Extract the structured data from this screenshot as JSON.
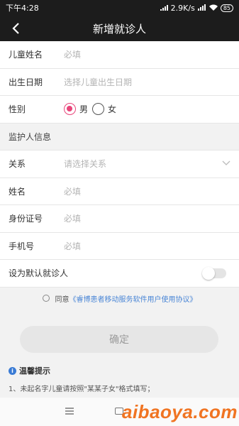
{
  "status_bar": {
    "time": "下午4:28",
    "network_speed": "2.9K/s",
    "battery": "85"
  },
  "header": {
    "title": "新增就诊人",
    "back_icon": "chevron-left-icon"
  },
  "form": {
    "child_name": {
      "label": "儿童姓名",
      "placeholder": "必填"
    },
    "birth_date": {
      "label": "出生日期",
      "placeholder": "选择儿童出生日期"
    },
    "gender": {
      "label": "性别",
      "options": [
        "男",
        "女"
      ],
      "selected": "男"
    },
    "guardian_section": "监护人信息",
    "relation": {
      "label": "关系",
      "placeholder": "请选择关系"
    },
    "name": {
      "label": "姓名",
      "placeholder": "必填"
    },
    "id_number": {
      "label": "身份证号",
      "placeholder": "必填"
    },
    "phone": {
      "label": "手机号",
      "placeholder": "必填"
    },
    "default_patient": {
      "label": "设为默认就诊人",
      "enabled": false
    }
  },
  "agreement": {
    "prefix": "同意",
    "link": "《睿博患者移动服务软件用户使用协议》"
  },
  "confirm_button": "确定",
  "tips": {
    "title": "温馨提示",
    "line1": "1、未起名字儿童请按照\"某某子女\"格式填写；"
  },
  "watermark": "aibaoya.com",
  "colors": {
    "header_bg": "#1c1c1c",
    "accent": "#e8457a",
    "link": "#4a86d6",
    "watermark": "#f07422"
  }
}
